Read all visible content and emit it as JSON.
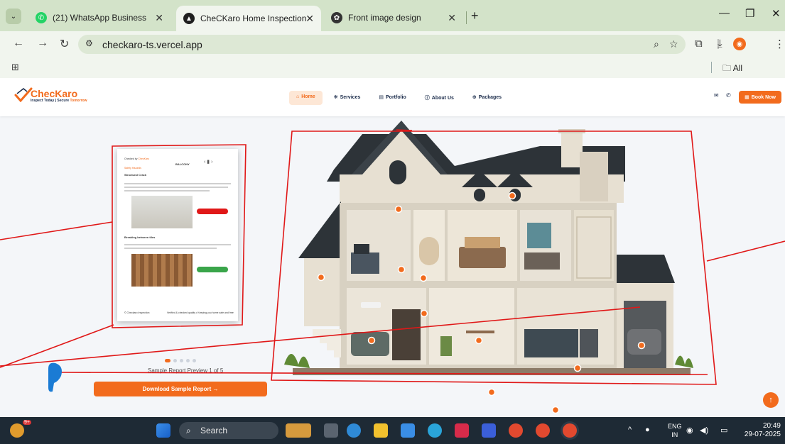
{
  "browser": {
    "tabs": [
      {
        "title": "(21) WhatsApp Business",
        "active": false
      },
      {
        "title": "CheCKaro Home Inspection - In",
        "active": true
      },
      {
        "title": "Front image design",
        "active": false
      }
    ],
    "url": "checkaro-ts.vercel.app",
    "all_bookmarks": "All Bookmarks"
  },
  "site": {
    "logo_name": "ChecKaro",
    "tagline_a": "Inspect Today | Secure ",
    "tagline_b": "Tomorrow",
    "nav": [
      {
        "label": "Home",
        "active": true
      },
      {
        "label": "Services",
        "active": false
      },
      {
        "label": "Portfolio",
        "active": false
      },
      {
        "label": "About Us",
        "active": false
      },
      {
        "label": "Packages",
        "active": false
      }
    ],
    "book_now": "Book Now",
    "report": {
      "header": "Checked by",
      "header_brand": "ChecKaro",
      "room": "BALCONY",
      "section": "Safety Hazards",
      "item1": "Structural Crack",
      "item2": "Breaking between tiles",
      "footer_left": "© Checkaro Inspection",
      "footer_right": "Verified & checked quality • Keeping you home safe and free"
    },
    "carousel_dots": 5,
    "preview_label": "Sample Report Preview 1 of 5",
    "download_button": "Download Sample Report →"
  },
  "taskbar": {
    "search_placeholder": "Search",
    "badge": "9+",
    "lang_a": "ENG",
    "lang_b": "IN",
    "time": "20:49",
    "date": "29-07-2025"
  },
  "colors": {
    "accent": "#f26b1d",
    "navy": "#1a2b4a",
    "annotation": "#e01818"
  }
}
